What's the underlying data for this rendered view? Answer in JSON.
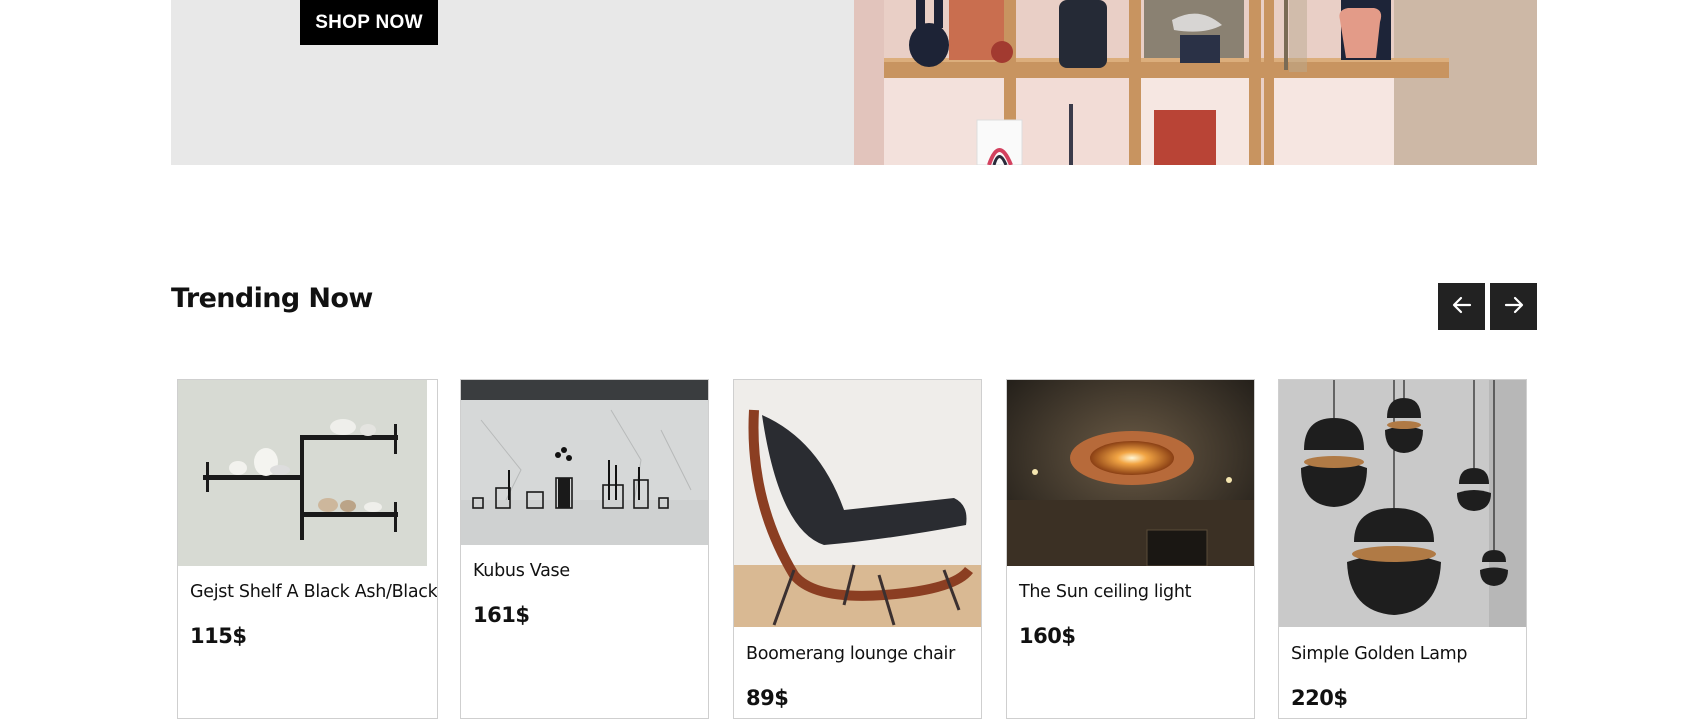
{
  "hero": {
    "cta_label": "SHOP NOW"
  },
  "trending": {
    "title": "Trending Now",
    "prev_icon": "arrow-left-icon",
    "next_icon": "arrow-right-icon",
    "products": [
      {
        "name": "Gejst Shelf A Black Ash/Black",
        "price": "115$",
        "image": "wall-shelf-with-ceramics"
      },
      {
        "name": "Kubus Vase",
        "price": "161$",
        "image": "black-wire-vases-on-concrete-wall"
      },
      {
        "name": "Boomerang lounge chair",
        "price": "89$",
        "image": "walnut-lounge-chair-black-cushions"
      },
      {
        "name": "The Sun ceiling light",
        "price": "160$",
        "image": "glowing-ceiling-light"
      },
      {
        "name": "Simple Golden Lamp",
        "price": "220$",
        "image": "black-pendant-lamps"
      }
    ]
  },
  "colors": {
    "button_bg": "#000000",
    "nav_bg": "#222222",
    "hero_panel": "#e8e8e8"
  }
}
